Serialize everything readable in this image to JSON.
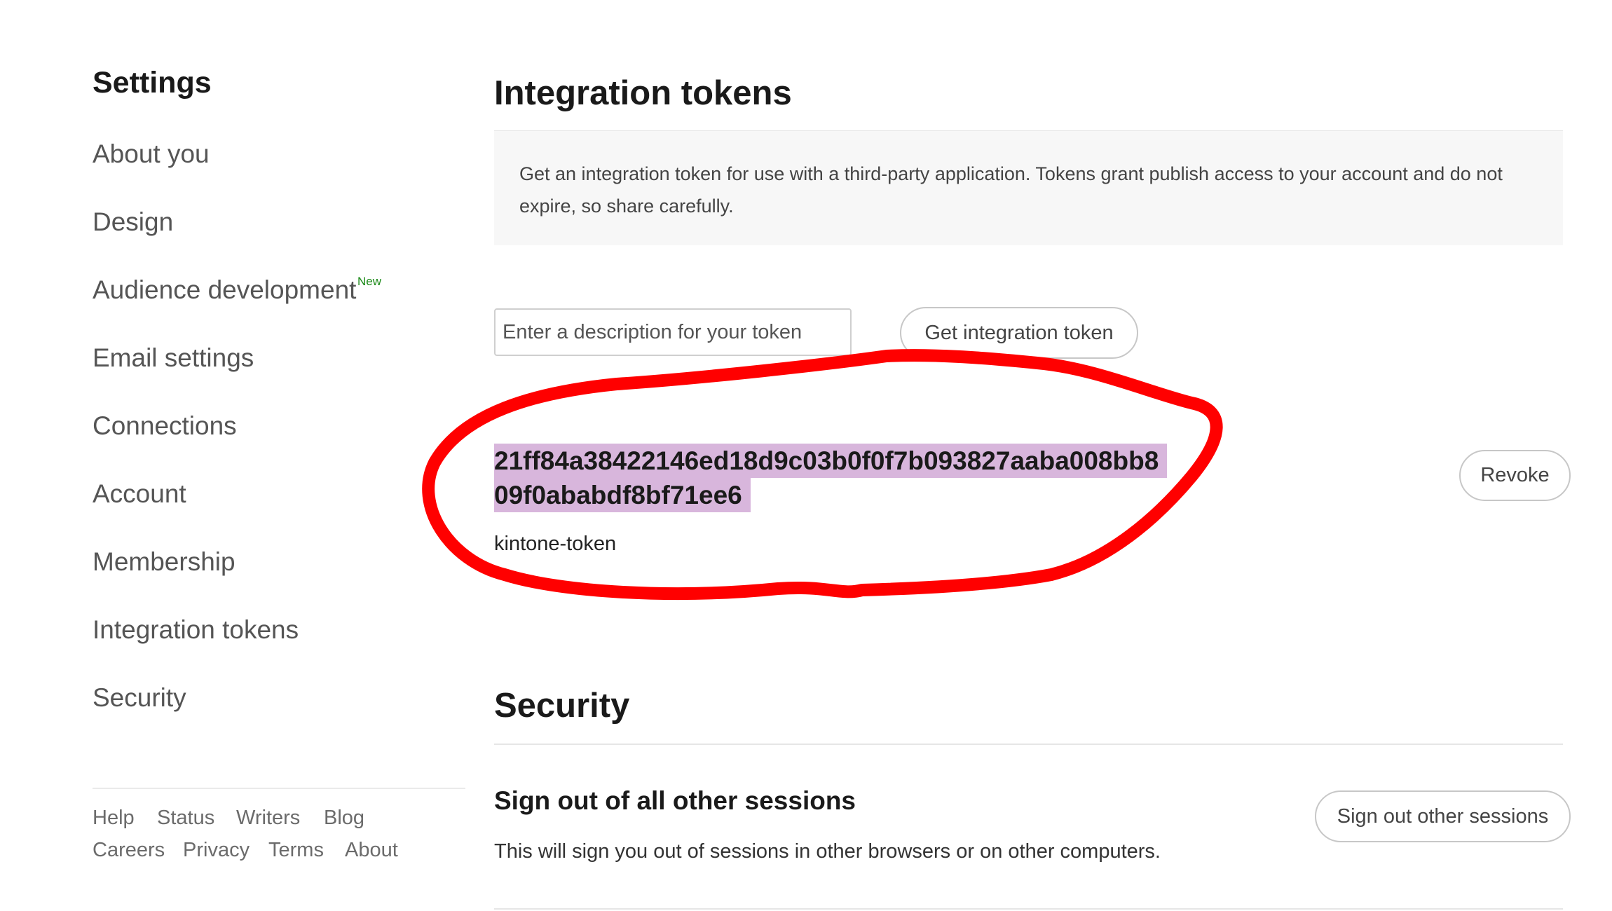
{
  "sidebar": {
    "title": "Settings",
    "items": [
      {
        "label": "About you"
      },
      {
        "label": "Design"
      },
      {
        "label": "Audience development",
        "badge": "New"
      },
      {
        "label": "Email settings"
      },
      {
        "label": "Connections"
      },
      {
        "label": "Account"
      },
      {
        "label": "Membership"
      },
      {
        "label": "Integration tokens"
      },
      {
        "label": "Security"
      }
    ],
    "footer_links": [
      "Help",
      "Status",
      "Writers",
      "Blog",
      "Careers",
      "Privacy",
      "Terms",
      "About"
    ]
  },
  "integration": {
    "heading": "Integration tokens",
    "info": "Get an integration token for use with a third-party application. Tokens grant publish access to your account and do not expire, so share carefully.",
    "input_placeholder": "Enter a description for your token",
    "get_button": "Get integration token",
    "token_line1": "21ff84a38422146ed18d9c03b0f0f7b093827aaba008bb8",
    "token_line2": "09f0ababdf8bf71ee6",
    "token_name": "kintone-token",
    "revoke_button": "Revoke"
  },
  "security": {
    "heading": "Security",
    "subheading": "Sign out of all other sessions",
    "description": "This will sign you out of sessions in other browsers or on other computers.",
    "button": "Sign out other sessions"
  },
  "colors": {
    "highlight": "#d8b6dc",
    "annotation": "#ff0000",
    "badge": "#1a8917"
  }
}
